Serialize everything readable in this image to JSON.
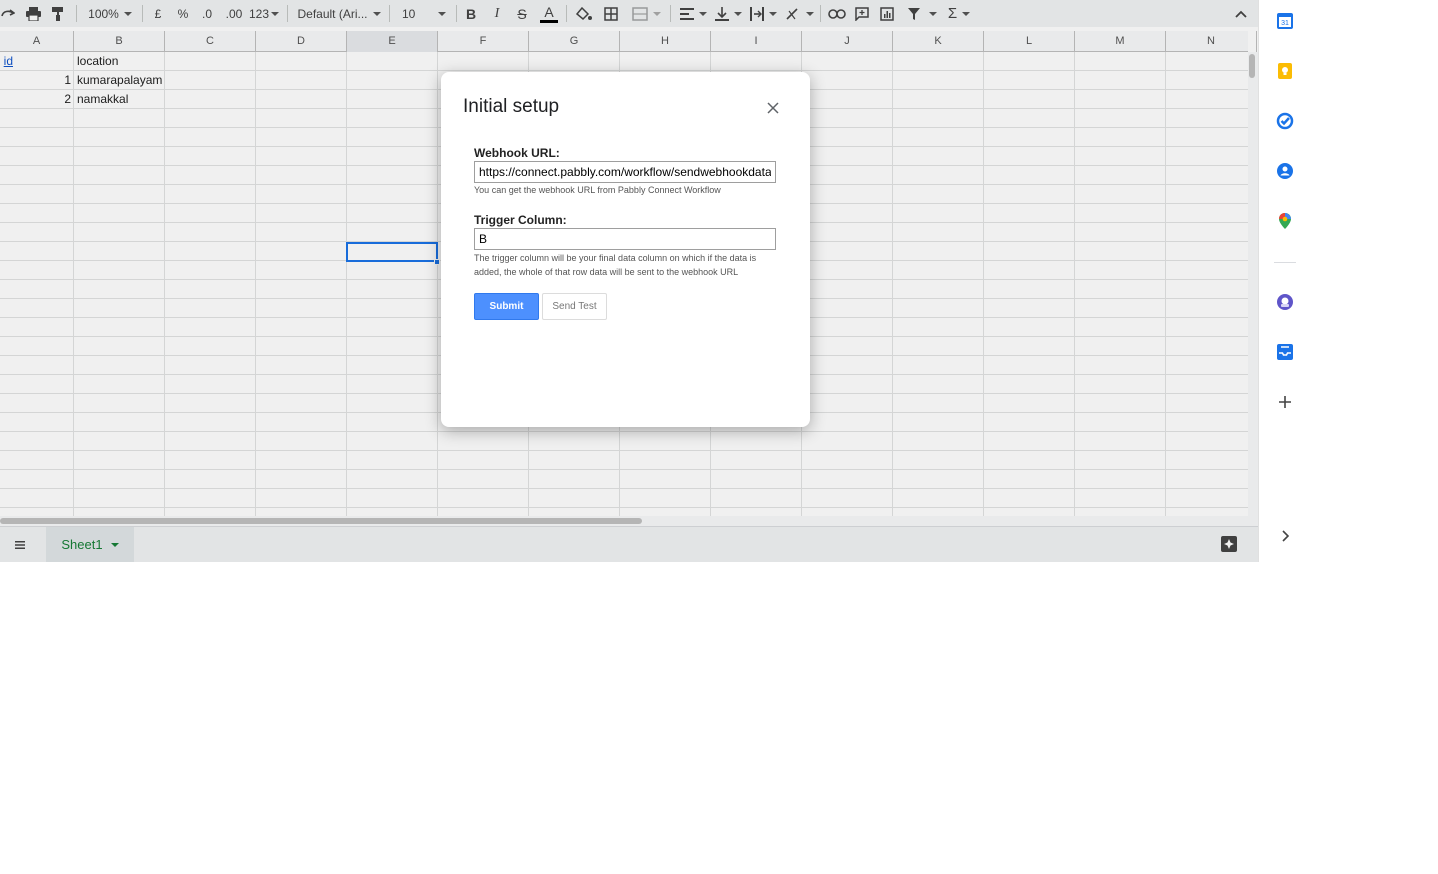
{
  "toolbar": {
    "zoom": "100%",
    "currency": "£",
    "percent": "%",
    "dec_decrease": ".0",
    "dec_increase": ".00",
    "more_formats": "123",
    "font_family": "Default (Ari...",
    "font_size": "10",
    "bold": "B",
    "italic": "I",
    "strikethrough": "S",
    "text_color": "A",
    "functions": "Σ"
  },
  "columns": [
    "A",
    "B",
    "C",
    "D",
    "E",
    "F",
    "G",
    "H",
    "I",
    "J",
    "K",
    "L",
    "M",
    "N"
  ],
  "rows": [
    {
      "a": "id",
      "b": "location"
    },
    {
      "a": "1",
      "b": "kumarapalayam"
    },
    {
      "a": "2",
      "b": "namakkal"
    }
  ],
  "sheet_tab": {
    "label": "Sheet1"
  },
  "dialog": {
    "title": "Initial setup",
    "webhook_label": "Webhook URL:",
    "webhook_value": "https://connect.pabbly.com/workflow/sendwebhookdata/Ij",
    "webhook_help": "You can get the webhook URL from Pabbly Connect Workflow",
    "trigger_label": "Trigger Column:",
    "trigger_value": "B",
    "trigger_help": "The trigger column will be your final data column on which if the data is added, the whole of that row data will be sent to the webhook URL",
    "submit_label": "Submit",
    "send_test_label": "Send Test"
  },
  "colors": {
    "accent": "#1a73e8",
    "submit": "#4d90fe",
    "sheet_tab_text": "#188038"
  }
}
